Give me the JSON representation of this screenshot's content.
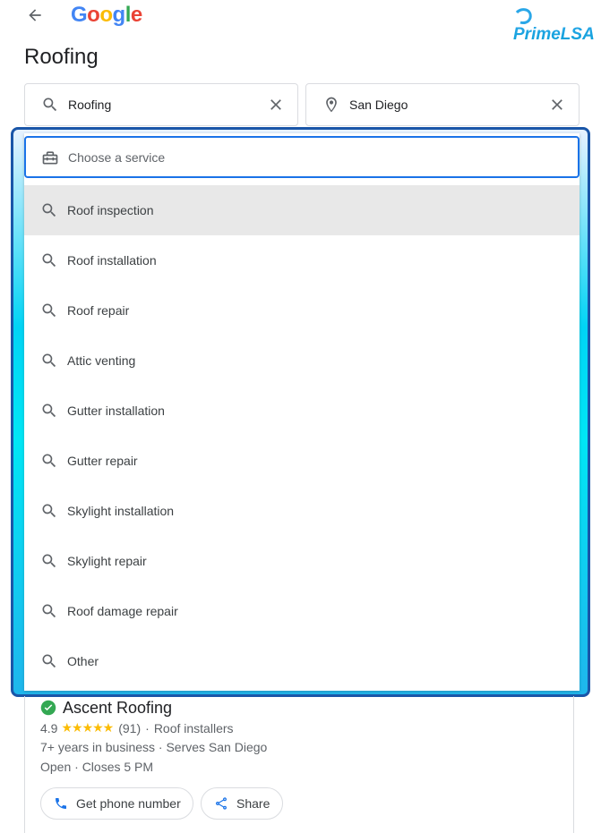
{
  "header": {
    "back_icon": "arrow-left-icon",
    "google_letters": [
      {
        "ch": "G",
        "color": "#4285F4"
      },
      {
        "ch": "o",
        "color": "#EA4335"
      },
      {
        "ch": "o",
        "color": "#FBBC05"
      },
      {
        "ch": "g",
        "color": "#4285F4"
      },
      {
        "ch": "l",
        "color": "#34A853"
      },
      {
        "ch": "e",
        "color": "#EA4335"
      }
    ],
    "brand_text": "PrimeLSA",
    "page_title": "Roofing"
  },
  "search": {
    "query_value": "Roofing",
    "query_icon": "search-icon",
    "location_value": "San Diego",
    "location_icon": "location-pin-icon",
    "clear_icon": "close-icon"
  },
  "service_picker": {
    "placeholder": "Choose a service",
    "input_icon": "toolbox-icon",
    "option_icon": "search-icon",
    "options": [
      {
        "label": "Roof inspection",
        "selected": true
      },
      {
        "label": "Roof installation",
        "selected": false
      },
      {
        "label": "Roof repair",
        "selected": false
      },
      {
        "label": "Attic venting",
        "selected": false
      },
      {
        "label": "Gutter installation",
        "selected": false
      },
      {
        "label": "Gutter repair",
        "selected": false
      },
      {
        "label": "Skylight installation",
        "selected": false
      },
      {
        "label": "Skylight repair",
        "selected": false
      },
      {
        "label": "Roof damage repair",
        "selected": false
      },
      {
        "label": "Other",
        "selected": false
      }
    ]
  },
  "result": {
    "name": "Ascent Roofing",
    "verified_icon": "check-circle-icon",
    "rating": "4.9",
    "stars": "★★★★★",
    "review_count": "(91)",
    "separator": "·",
    "category": "Roof installers",
    "years": "7+ years in business · Serves San Diego",
    "hours": "Open · Closes 5 PM",
    "phone_button": "Get phone number",
    "phone_icon": "phone-icon",
    "share_button": "Share",
    "share_icon": "share-icon"
  },
  "colors": {
    "accent": "#1a73e8",
    "frame": "#1a56a8",
    "star": "#fbbc04",
    "verified": "#34a853"
  }
}
